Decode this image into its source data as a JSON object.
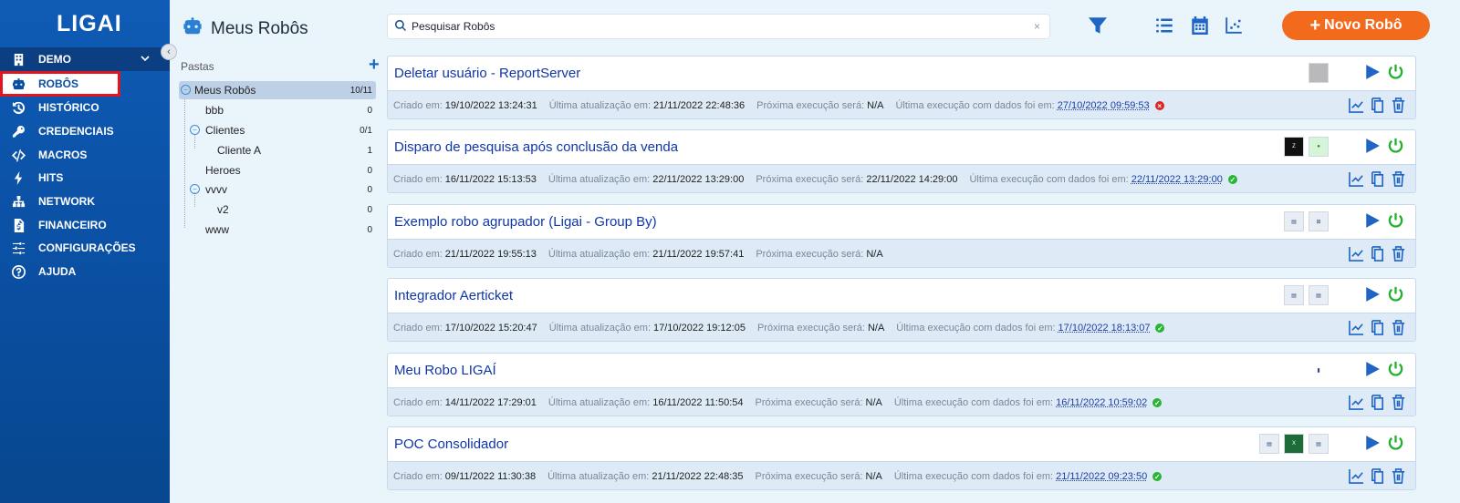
{
  "app": {
    "logo": "LIGAI"
  },
  "sidebar": {
    "items": [
      {
        "label": "DEMO",
        "icon": "building-icon"
      },
      {
        "label": "ROBÔS",
        "icon": "robot-icon"
      },
      {
        "label": "HISTÓRICO",
        "icon": "history-icon"
      },
      {
        "label": "CREDENCIAIS",
        "icon": "key-icon"
      },
      {
        "label": "MACROS",
        "icon": "code-icon"
      },
      {
        "label": "HITS",
        "icon": "bolt-icon"
      },
      {
        "label": "NETWORK",
        "icon": "network-icon"
      },
      {
        "label": "FINANCEIRO",
        "icon": "invoice-icon"
      },
      {
        "label": "CONFIGURAÇÕES",
        "icon": "sliders-icon"
      },
      {
        "label": "AJUDA",
        "icon": "help-icon"
      }
    ],
    "selected": "ROBÔS"
  },
  "header": {
    "title": "Meus Robôs"
  },
  "folders": {
    "title": "Pastas",
    "tree": [
      {
        "name": "Meus Robôs",
        "count": "10/11"
      },
      {
        "name": "bbb",
        "count": "0"
      },
      {
        "name": "Clientes",
        "count": "0/1"
      },
      {
        "name": "Cliente A",
        "count": "1"
      },
      {
        "name": "Heroes",
        "count": "0"
      },
      {
        "name": "vvvv",
        "count": "0"
      },
      {
        "name": "v2",
        "count": "0"
      },
      {
        "name": "www",
        "count": "0"
      }
    ]
  },
  "search": {
    "placeholder": "Pesquisar Robôs",
    "value": ""
  },
  "toolbar": {
    "new_label": "Novo Robô"
  },
  "labels": {
    "created": "Criado em:",
    "updated": "Última atualização em:",
    "next": "Próxima execução será:",
    "last": "Última execução com dados foi em:"
  },
  "robots": [
    {
      "name": "Deletar usuário - ReportServer",
      "created": "19/10/2022 13:24:31",
      "updated": "21/11/2022 22:48:36",
      "next": "N/A",
      "last": "27/10/2022 09:59:53",
      "status": "error"
    },
    {
      "name": "Disparo de pesquisa após conclusão da venda",
      "created": "16/11/2022 15:13:53",
      "updated": "22/11/2022 13:29:00",
      "next": "22/11/2022 14:29:00",
      "last": "22/11/2022 13:29:00",
      "status": "ok"
    },
    {
      "name": "Exemplo robo agrupador (Ligai - Group By)",
      "created": "21/11/2022 19:55:13",
      "updated": "21/11/2022 19:57:41",
      "next": "N/A",
      "last": "",
      "status": ""
    },
    {
      "name": "Integrador Aerticket",
      "created": "17/10/2022 15:20:47",
      "updated": "17/10/2022 19:12:05",
      "next": "N/A",
      "last": "17/10/2022 18:13:07",
      "status": "ok"
    },
    {
      "name": "Meu Robo LIGAÍ",
      "created": "14/11/2022 17:29:01",
      "updated": "16/11/2022 11:50:54",
      "next": "N/A",
      "last": "16/11/2022 10:59:02",
      "status": "ok"
    },
    {
      "name": "POC Consolidador",
      "created": "09/11/2022 11:30:38",
      "updated": "21/11/2022 22:48:35",
      "next": "N/A",
      "last": "21/11/2022 09:23:50",
      "status": "ok"
    }
  ],
  "colors": {
    "sidebar": "#0a4fa2",
    "accent": "#f26b1d",
    "primary": "#1f65c5",
    "success": "#27b533",
    "error": "#e02525",
    "highlight": "#e0151f"
  }
}
